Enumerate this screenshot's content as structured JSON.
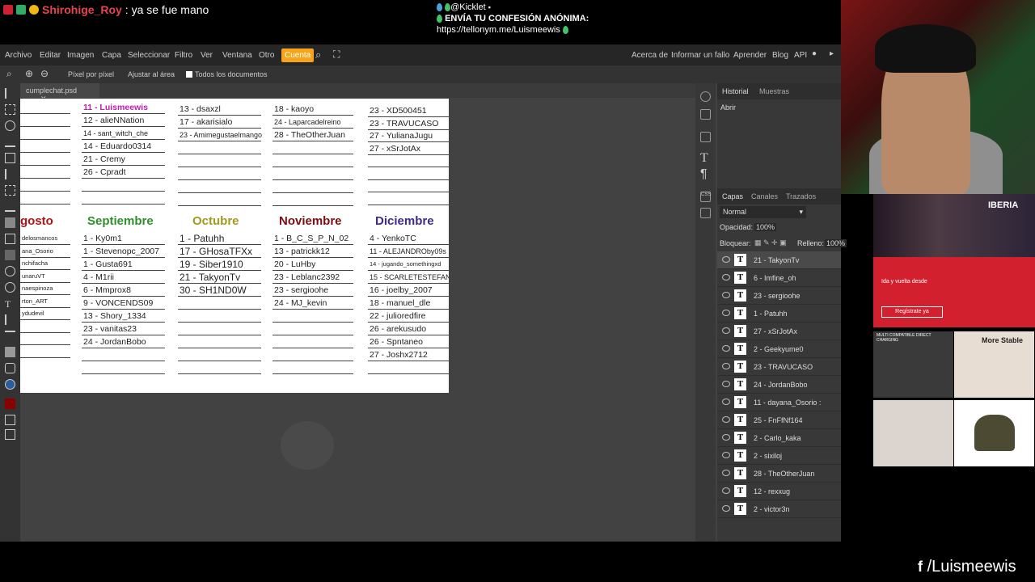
{
  "stream": {
    "chat_user": "Shirohige_Roy",
    "chat_message": ": ya se fue mano",
    "kick_handle": "@Kicklet",
    "confession_line1": "ENVÍA TU CONFESIÓN ANÓNIMA:",
    "confession_line2": "https://tellonym.me/Luismeewis",
    "social_handle": "/Luismeewis",
    "ad_brand": "IBERIA",
    "ad_text": "Ida y vuelta desde",
    "ad_button": "Regístrate ya",
    "ad_banner": "MULTI COMPATIBLE DIRECT CHARGING",
    "ad_banner2": "More Stable"
  },
  "menu": [
    "Archivo",
    "Editar",
    "Imagen",
    "Capa",
    "Seleccionar",
    "Filtro",
    "Ver",
    "Ventana",
    "Otro",
    "Cuenta"
  ],
  "menu_right": [
    "Acerca de",
    "Informar un fallo",
    "Aprender",
    "Blog",
    "API"
  ],
  "options": {
    "pixel": "Píxel por píxel",
    "fit": "Ajustar al área",
    "all_docs": "Todos los documentos"
  },
  "tab": {
    "name": "cumplechat.psd",
    "close": "✕"
  },
  "history": {
    "tab1": "Historial",
    "tab2": "Muestras",
    "item": "Abrir"
  },
  "layers_panel": {
    "tab1": "Capas",
    "tab2": "Canales",
    "tab3": "Trazados",
    "blend": "Normal",
    "opacity_label": "Opacidad:",
    "opacity": "100%",
    "lock_label": "Bloquear:",
    "fill_label": "Relleno:",
    "fill": "100%",
    "items": [
      "21 - TakyonTv",
      "6 - Imfine_oh",
      "23 - sergioohe",
      "1 - Patuhh",
      "27 - xSrJotAx",
      "2 - Geekyume0",
      "23 - TRAVUCASO",
      "24 - JordanBobo",
      "11 - dayana_Osorio :",
      "25 - FnFfNf164",
      "2 - Carlo_kaka",
      "2 - sixiloj",
      "28 - TheOtherJuan",
      "12 - rexxug",
      "2 - victor3n"
    ]
  },
  "doc": {
    "top_cols": [
      {
        "rows": [
          "11 - Luismeewis",
          "12 - alieNNation",
          "14 - sant_witch_che",
          "14 - Eduardo0314",
          "21 - Cremy",
          "26 - Cpradt",
          "",
          ""
        ]
      },
      {
        "rows": [
          "13 - dsaxzl",
          "17 - akarisialo",
          "23 - Amimegustaelmango",
          "",
          "",
          "",
          "",
          ""
        ]
      },
      {
        "rows": [
          "18 - kaoyo",
          "24 - Laparcadelreino",
          "28 - TheOtherJuan",
          "",
          "",
          "",
          "",
          ""
        ]
      },
      {
        "rows": [
          "23 - XD500451",
          "23 - TRAVUCASO",
          "27 - YulianaJugu",
          "27 - xSrJotAx",
          "",
          "",
          "",
          ""
        ]
      }
    ],
    "months": [
      "gosto",
      "Septiembre",
      "Octubre",
      "Noviembre",
      "Diciembre"
    ],
    "month_colors": [
      "#b01313",
      "#2f8f2a",
      "#a29a1d",
      "#7a0f12",
      "#3f2a8a"
    ],
    "agosto_rows": [
      "delosmancos",
      "ana_Osorio",
      "nchifacha",
      "unaruVT",
      "naespinoza",
      "rton_ART",
      "ydudevil",
      "",
      "",
      ""
    ],
    "sep_rows": [
      "1 - Ky0m1",
      "1 - Stevenopc_2007",
      "1 - Gusta691",
      "4 - M1rii",
      "6 - Mmprox8",
      "9 - VONCENDS09",
      "13 - Shory_1334",
      "23 - vanitas23",
      "24 - JordanBobo",
      "",
      ""
    ],
    "oct_rows": [
      "1 - Patuhh",
      "17 - GHosaTFXx",
      "19 - Siber1910",
      "21 - TakyonTv",
      "30 - SH1ND0W",
      "",
      "",
      "",
      "",
      "",
      ""
    ],
    "nov_rows": [
      "1 - B_C_S_P_N_02",
      "13 - patrickk12",
      "20 - LuHby",
      "23 - Leblanc2392",
      "23 - sergioohe",
      "24 - MJ_kevin",
      "",
      "",
      "",
      "",
      ""
    ],
    "dic_rows": [
      "4 - YenkoTC",
      "11 - ALEJANDROby09s",
      "14 - jugando_somethingxd",
      "15 - SCARLETESTEFANIA",
      "16 - joelby_2007",
      "18 - manuel_dle",
      "22 - julioredfire",
      "26 - arekusudo",
      "26 - Spntaneo",
      "27 - Joshx2712",
      ""
    ]
  }
}
